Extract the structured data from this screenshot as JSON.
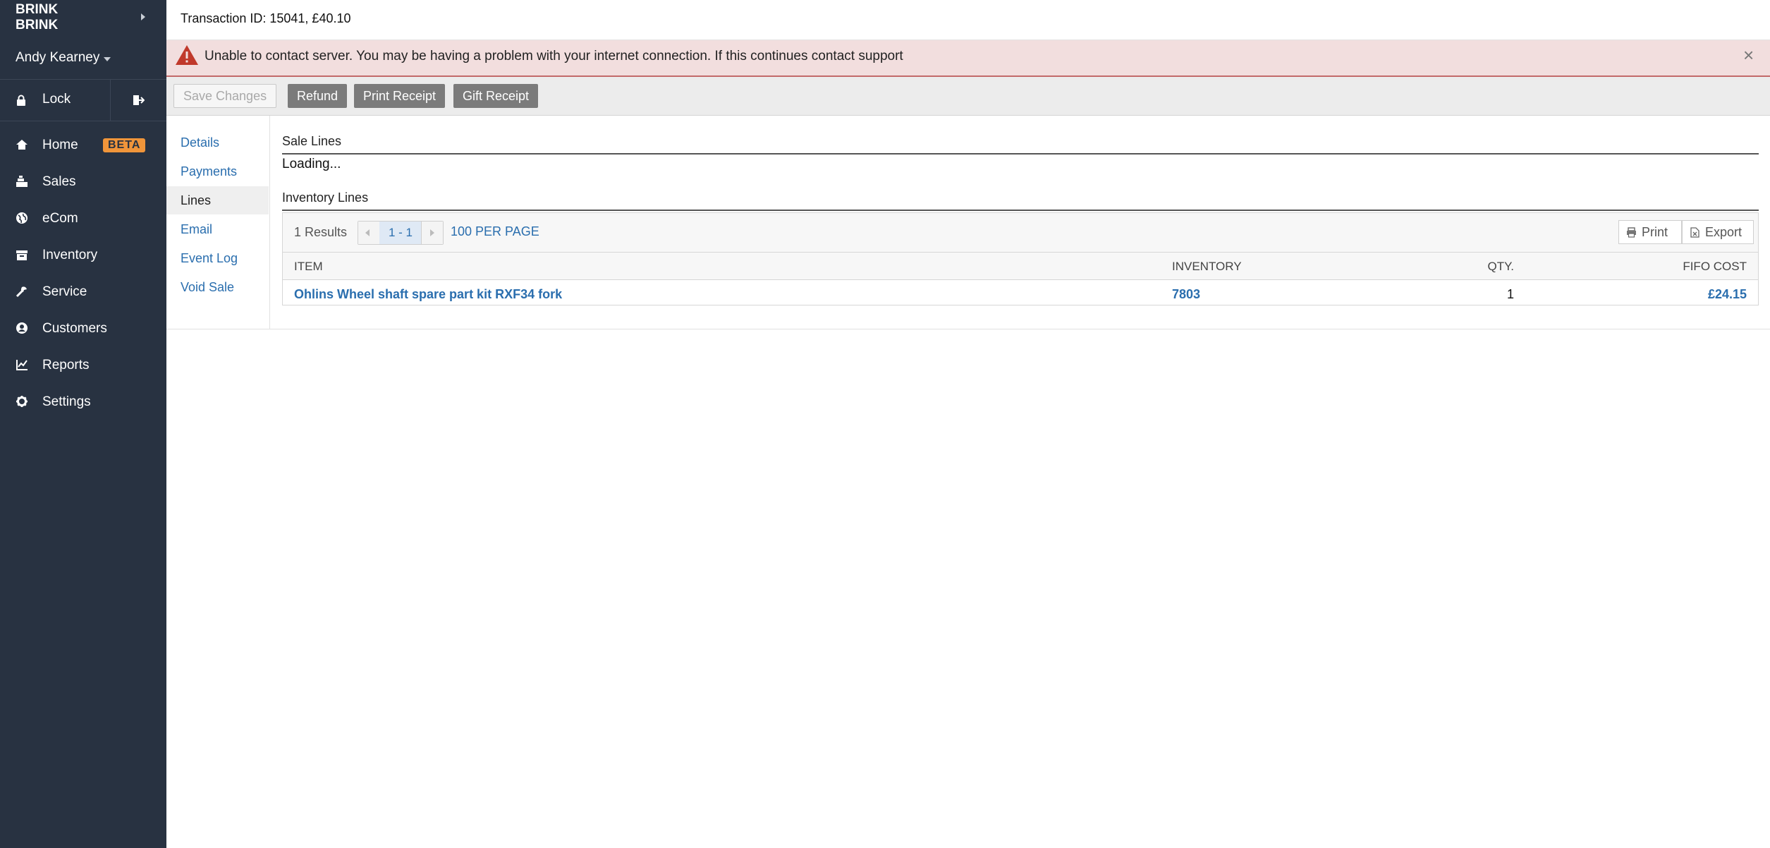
{
  "sidebar": {
    "brand_line1": "BRINK",
    "brand_line2": "BRINK",
    "user": "Andy Kearney",
    "lock_label": "Lock",
    "nav": [
      {
        "label": "Home",
        "icon": "home-icon",
        "badge": "BETA"
      },
      {
        "label": "Sales",
        "icon": "register-icon"
      },
      {
        "label": "eCom",
        "icon": "globe-icon"
      },
      {
        "label": "Inventory",
        "icon": "box-icon"
      },
      {
        "label": "Service",
        "icon": "wrench-icon"
      },
      {
        "label": "Customers",
        "icon": "user-circle-icon"
      },
      {
        "label": "Reports",
        "icon": "chart-icon"
      },
      {
        "label": "Settings",
        "icon": "gear-icon"
      }
    ]
  },
  "header": {
    "title": "Transaction ID: 15041, £40.10"
  },
  "alert": {
    "message": "Unable to contact server. You may be having a problem with your internet connection. If this continues contact support",
    "close": "×"
  },
  "toolbar": {
    "save_label": "Save Changes",
    "refund_label": "Refund",
    "print_receipt_label": "Print Receipt",
    "gift_receipt_label": "Gift Receipt"
  },
  "subnav": {
    "items": [
      "Details",
      "Payments",
      "Lines",
      "Email",
      "Event Log",
      "Void Sale"
    ],
    "active": "Lines"
  },
  "sale_lines": {
    "title": "Sale Lines",
    "status": "Loading..."
  },
  "inventory_lines": {
    "title": "Inventory Lines",
    "results": "1 Results",
    "page_range": "1 - 1",
    "per_page": "100 PER PAGE",
    "print_label": "Print",
    "export_label": "Export",
    "columns": [
      "ITEM",
      "INVENTORY",
      "QTY.",
      "FIFO COST"
    ],
    "rows": [
      {
        "item": "Ohlins Wheel shaft spare part kit RXF34 fork",
        "inventory": "7803",
        "qty": "1",
        "fifo_cost": "£24.15"
      }
    ]
  },
  "colors": {
    "sidebar_bg": "#283241",
    "beta_badge": "#f0953a",
    "alert_bg": "#f2dede",
    "alert_icon": "#c0392b",
    "link": "#2a6eae"
  }
}
